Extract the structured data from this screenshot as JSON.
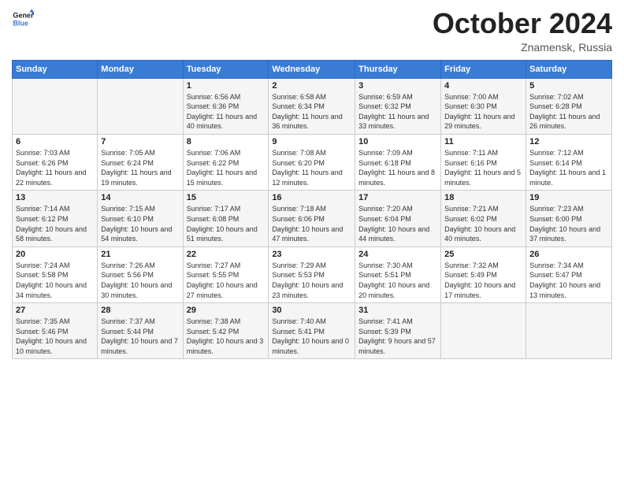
{
  "logo": {
    "line1": "General",
    "line2": "Blue"
  },
  "title": "October 2024",
  "subtitle": "Znamensk, Russia",
  "days_header": [
    "Sunday",
    "Monday",
    "Tuesday",
    "Wednesday",
    "Thursday",
    "Friday",
    "Saturday"
  ],
  "weeks": [
    [
      {
        "day": "",
        "sunrise": "",
        "sunset": "",
        "daylight": ""
      },
      {
        "day": "",
        "sunrise": "",
        "sunset": "",
        "daylight": ""
      },
      {
        "day": "1",
        "sunrise": "Sunrise: 6:56 AM",
        "sunset": "Sunset: 6:36 PM",
        "daylight": "Daylight: 11 hours and 40 minutes."
      },
      {
        "day": "2",
        "sunrise": "Sunrise: 6:58 AM",
        "sunset": "Sunset: 6:34 PM",
        "daylight": "Daylight: 11 hours and 36 minutes."
      },
      {
        "day": "3",
        "sunrise": "Sunrise: 6:59 AM",
        "sunset": "Sunset: 6:32 PM",
        "daylight": "Daylight: 11 hours and 33 minutes."
      },
      {
        "day": "4",
        "sunrise": "Sunrise: 7:00 AM",
        "sunset": "Sunset: 6:30 PM",
        "daylight": "Daylight: 11 hours and 29 minutes."
      },
      {
        "day": "5",
        "sunrise": "Sunrise: 7:02 AM",
        "sunset": "Sunset: 6:28 PM",
        "daylight": "Daylight: 11 hours and 26 minutes."
      }
    ],
    [
      {
        "day": "6",
        "sunrise": "Sunrise: 7:03 AM",
        "sunset": "Sunset: 6:26 PM",
        "daylight": "Daylight: 11 hours and 22 minutes."
      },
      {
        "day": "7",
        "sunrise": "Sunrise: 7:05 AM",
        "sunset": "Sunset: 6:24 PM",
        "daylight": "Daylight: 11 hours and 19 minutes."
      },
      {
        "day": "8",
        "sunrise": "Sunrise: 7:06 AM",
        "sunset": "Sunset: 6:22 PM",
        "daylight": "Daylight: 11 hours and 15 minutes."
      },
      {
        "day": "9",
        "sunrise": "Sunrise: 7:08 AM",
        "sunset": "Sunset: 6:20 PM",
        "daylight": "Daylight: 11 hours and 12 minutes."
      },
      {
        "day": "10",
        "sunrise": "Sunrise: 7:09 AM",
        "sunset": "Sunset: 6:18 PM",
        "daylight": "Daylight: 11 hours and 8 minutes."
      },
      {
        "day": "11",
        "sunrise": "Sunrise: 7:11 AM",
        "sunset": "Sunset: 6:16 PM",
        "daylight": "Daylight: 11 hours and 5 minutes."
      },
      {
        "day": "12",
        "sunrise": "Sunrise: 7:12 AM",
        "sunset": "Sunset: 6:14 PM",
        "daylight": "Daylight: 11 hours and 1 minute."
      }
    ],
    [
      {
        "day": "13",
        "sunrise": "Sunrise: 7:14 AM",
        "sunset": "Sunset: 6:12 PM",
        "daylight": "Daylight: 10 hours and 58 minutes."
      },
      {
        "day": "14",
        "sunrise": "Sunrise: 7:15 AM",
        "sunset": "Sunset: 6:10 PM",
        "daylight": "Daylight: 10 hours and 54 minutes."
      },
      {
        "day": "15",
        "sunrise": "Sunrise: 7:17 AM",
        "sunset": "Sunset: 6:08 PM",
        "daylight": "Daylight: 10 hours and 51 minutes."
      },
      {
        "day": "16",
        "sunrise": "Sunrise: 7:18 AM",
        "sunset": "Sunset: 6:06 PM",
        "daylight": "Daylight: 10 hours and 47 minutes."
      },
      {
        "day": "17",
        "sunrise": "Sunrise: 7:20 AM",
        "sunset": "Sunset: 6:04 PM",
        "daylight": "Daylight: 10 hours and 44 minutes."
      },
      {
        "day": "18",
        "sunrise": "Sunrise: 7:21 AM",
        "sunset": "Sunset: 6:02 PM",
        "daylight": "Daylight: 10 hours and 40 minutes."
      },
      {
        "day": "19",
        "sunrise": "Sunrise: 7:23 AM",
        "sunset": "Sunset: 6:00 PM",
        "daylight": "Daylight: 10 hours and 37 minutes."
      }
    ],
    [
      {
        "day": "20",
        "sunrise": "Sunrise: 7:24 AM",
        "sunset": "Sunset: 5:58 PM",
        "daylight": "Daylight: 10 hours and 34 minutes."
      },
      {
        "day": "21",
        "sunrise": "Sunrise: 7:26 AM",
        "sunset": "Sunset: 5:56 PM",
        "daylight": "Daylight: 10 hours and 30 minutes."
      },
      {
        "day": "22",
        "sunrise": "Sunrise: 7:27 AM",
        "sunset": "Sunset: 5:55 PM",
        "daylight": "Daylight: 10 hours and 27 minutes."
      },
      {
        "day": "23",
        "sunrise": "Sunrise: 7:29 AM",
        "sunset": "Sunset: 5:53 PM",
        "daylight": "Daylight: 10 hours and 23 minutes."
      },
      {
        "day": "24",
        "sunrise": "Sunrise: 7:30 AM",
        "sunset": "Sunset: 5:51 PM",
        "daylight": "Daylight: 10 hours and 20 minutes."
      },
      {
        "day": "25",
        "sunrise": "Sunrise: 7:32 AM",
        "sunset": "Sunset: 5:49 PM",
        "daylight": "Daylight: 10 hours and 17 minutes."
      },
      {
        "day": "26",
        "sunrise": "Sunrise: 7:34 AM",
        "sunset": "Sunset: 5:47 PM",
        "daylight": "Daylight: 10 hours and 13 minutes."
      }
    ],
    [
      {
        "day": "27",
        "sunrise": "Sunrise: 7:35 AM",
        "sunset": "Sunset: 5:46 PM",
        "daylight": "Daylight: 10 hours and 10 minutes."
      },
      {
        "day": "28",
        "sunrise": "Sunrise: 7:37 AM",
        "sunset": "Sunset: 5:44 PM",
        "daylight": "Daylight: 10 hours and 7 minutes."
      },
      {
        "day": "29",
        "sunrise": "Sunrise: 7:38 AM",
        "sunset": "Sunset: 5:42 PM",
        "daylight": "Daylight: 10 hours and 3 minutes."
      },
      {
        "day": "30",
        "sunrise": "Sunrise: 7:40 AM",
        "sunset": "Sunset: 5:41 PM",
        "daylight": "Daylight: 10 hours and 0 minutes."
      },
      {
        "day": "31",
        "sunrise": "Sunrise: 7:41 AM",
        "sunset": "Sunset: 5:39 PM",
        "daylight": "Daylight: 9 hours and 57 minutes."
      },
      {
        "day": "",
        "sunrise": "",
        "sunset": "",
        "daylight": ""
      },
      {
        "day": "",
        "sunrise": "",
        "sunset": "",
        "daylight": ""
      }
    ]
  ]
}
